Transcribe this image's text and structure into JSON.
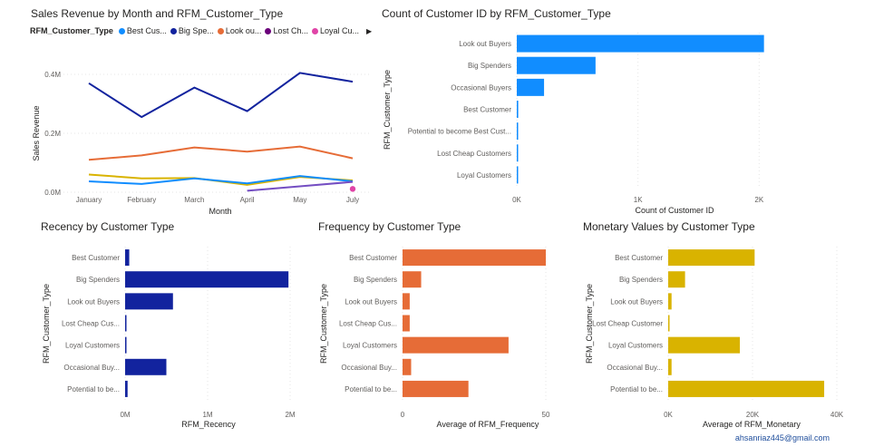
{
  "footer": {
    "email": "ahsanriaz445@gmail.com"
  },
  "colors": {
    "line_loyal_point": "#e044a7",
    "bar_count": "#118dff",
    "bar_recency": "#12239e",
    "bar_frequency": "#e66c37",
    "bar_monetary": "#d9b300",
    "gridline": "#e6e6e6",
    "axis_text": "#605e5c"
  },
  "legend": {
    "title": "RFM_Customer_Type",
    "items": [
      {
        "label": "Best Cus...",
        "color": "#118dff"
      },
      {
        "label": "Big Spe...",
        "color": "#12239e"
      },
      {
        "label": "Look ou...",
        "color": "#e66c37"
      },
      {
        "label": "Lost Ch...",
        "color": "#6b007b"
      },
      {
        "label": "Loyal Cu...",
        "color": "#e044a7"
      }
    ],
    "more_icon": "chevron-right-icon"
  },
  "chart_data": [
    {
      "id": "sales",
      "type": "line",
      "title": "Sales Revenue by Month and RFM_Customer_Type",
      "xlabel": "Month",
      "ylabel": "Sales Revenue",
      "categories": [
        "January",
        "February",
        "March",
        "April",
        "May",
        "July"
      ],
      "yticks": [
        "0.0M",
        "0.2M",
        "0.4M"
      ],
      "ylim": [
        0,
        0.45
      ],
      "grid": true,
      "series": [
        {
          "color": "#12239e",
          "values": [
            0.37,
            0.255,
            0.355,
            0.275,
            0.405,
            0.375
          ]
        },
        {
          "color": "#e66c37",
          "values": [
            0.11,
            0.125,
            0.152,
            0.138,
            0.155,
            0.115
          ]
        },
        {
          "color": "#d9b300",
          "values": [
            0.06,
            0.047,
            0.048,
            0.025,
            0.052,
            0.04
          ]
        },
        {
          "color": "#118dff",
          "values": [
            0.037,
            0.028,
            0.047,
            0.03,
            0.055,
            0.037
          ]
        },
        {
          "color": "#744ec2",
          "values": [
            null,
            null,
            null,
            0.005,
            0.02,
            0.035
          ]
        }
      ],
      "points": [
        {
          "series": "Loyal Cu...",
          "x": "July",
          "y": 0.005,
          "color": "#e044a7"
        }
      ]
    },
    {
      "id": "count",
      "type": "bar",
      "orientation": "horizontal",
      "title": "Count of Customer ID by RFM_Customer_Type",
      "xlabel": "Count of Customer ID",
      "ylabel": "RFM_Customer_Type",
      "categories": [
        "Look out Buyers",
        "Big Spenders",
        "Occasional Buyers",
        "Best Customer",
        "Potential to become Best Cust...",
        "Lost Cheap Customers",
        "Loyal Customers"
      ],
      "values": [
        2040,
        650,
        225,
        12,
        10,
        6,
        5
      ],
      "xticks": [
        "0K",
        "1K",
        "2K"
      ],
      "xtick_values": [
        0,
        1000,
        2000
      ],
      "xlim": [
        0,
        2080
      ],
      "color": "#118dff"
    },
    {
      "id": "recency",
      "type": "bar",
      "orientation": "horizontal",
      "title": "Recency by Customer Type",
      "xlabel": "RFM_Recency",
      "ylabel": "RFM_Customer_Type",
      "categories": [
        "Best Customer",
        "Big Spenders",
        "Look out Buyers",
        "Lost Cheap Cus...",
        "Loyal Customers",
        "Occasional Buy...",
        "Potential to be..."
      ],
      "values": [
        50000,
        1980000,
        580000,
        5000,
        5000,
        500000,
        30000
      ],
      "xticks": [
        "0M",
        "1M",
        "2M"
      ],
      "xtick_values": [
        0,
        1000000,
        2000000
      ],
      "xlim": [
        0,
        2000000
      ],
      "color": "#12239e"
    },
    {
      "id": "frequency",
      "type": "bar",
      "orientation": "horizontal",
      "title": "Frequency by Customer Type",
      "xlabel": "Average of RFM_Frequency",
      "ylabel": "RFM_Customer_Type",
      "categories": [
        "Best Customer",
        "Big Spenders",
        "Look out Buyers",
        "Lost Cheap Cus...",
        "Loyal Customers",
        "Occasional Buy...",
        "Potential to be..."
      ],
      "values": [
        50,
        6.5,
        2.5,
        2.5,
        37,
        3,
        23
      ],
      "xticks": [
        "0",
        "50"
      ],
      "xtick_values": [
        0,
        50
      ],
      "xlim": [
        0,
        50
      ],
      "color": "#e66c37"
    },
    {
      "id": "monetary",
      "type": "bar",
      "orientation": "horizontal",
      "title": "Monetary Values by Customer Type",
      "xlabel": "Average of RFM_Monetary",
      "ylabel": "RFM_Customer_Type",
      "categories": [
        "Best Customer",
        "Big Spenders",
        "Look out Buyers",
        "Lost Cheap Customer",
        "Loyal Customers",
        "Occasional Buy...",
        "Potential to be..."
      ],
      "values": [
        20500,
        4000,
        800,
        200,
        17000,
        800,
        37000
      ],
      "xticks": [
        "0K",
        "20K",
        "40K"
      ],
      "xtick_values": [
        0,
        20000,
        40000
      ],
      "xlim": [
        0,
        40000
      ],
      "color": "#d9b300"
    }
  ]
}
